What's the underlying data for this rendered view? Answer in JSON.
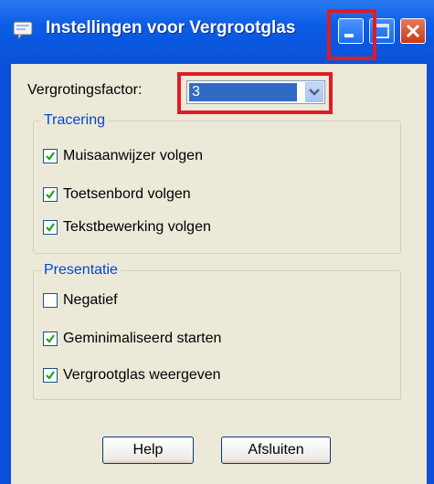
{
  "window": {
    "title": "Instellingen voor Vergrootglas",
    "icon": "magnifier-settings-icon",
    "buttons": [
      "minimize",
      "maximize",
      "close"
    ]
  },
  "zoom": {
    "label": "Vergrotingsfactor:",
    "value": "3"
  },
  "tracking": {
    "title": "Tracering",
    "items": [
      {
        "label": "Muisaanwijzer volgen",
        "checked": true
      },
      {
        "label": "Toetsenbord volgen",
        "checked": true
      },
      {
        "label": "Tekstbewerking volgen",
        "checked": true
      }
    ]
  },
  "presentation": {
    "title": "Presentatie",
    "items": [
      {
        "label": "Negatief",
        "checked": false
      },
      {
        "label": "Geminimaliseerd starten",
        "checked": true
      },
      {
        "label": "Vergrootglas weergeven",
        "checked": true
      }
    ]
  },
  "buttons": {
    "help": "Help",
    "exit": "Afsluiten"
  },
  "colors": {
    "titlebar": "#0a52d6",
    "dialog_bg": "#ece9d8",
    "group_title": "#0046d5",
    "highlight": "#e01b24",
    "selection": "#316ac5"
  }
}
